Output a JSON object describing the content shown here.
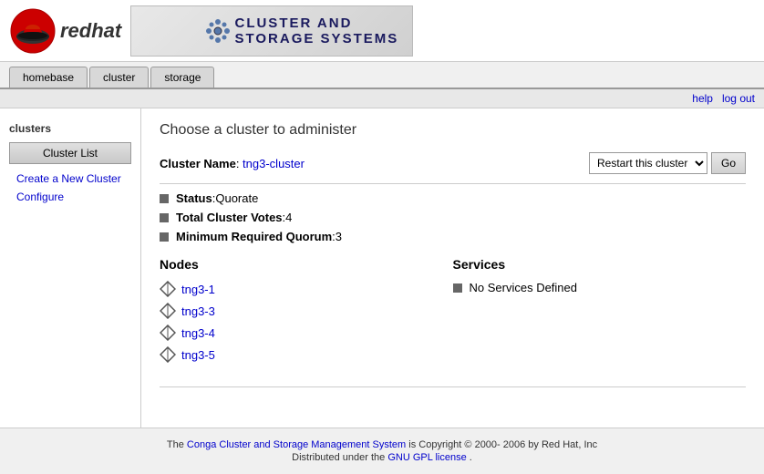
{
  "header": {
    "logo_text": "redhat",
    "banner_title_line1": "CLUSTER AND",
    "banner_title_line2": "STORAGE SYSTEMS"
  },
  "nav": {
    "tabs": [
      {
        "label": "homebase",
        "id": "homebase"
      },
      {
        "label": "cluster",
        "id": "cluster"
      },
      {
        "label": "storage",
        "id": "storage"
      }
    ]
  },
  "utility": {
    "help_label": "help",
    "logout_label": "log out"
  },
  "sidebar": {
    "title": "clusters",
    "cluster_list_btn": "Cluster List",
    "create_link": "Create a New Cluster",
    "configure_link": "Configure"
  },
  "content": {
    "page_title": "Choose a cluster to administer",
    "cluster_name_label": "Cluster Name",
    "cluster_name_value": "tng3-cluster",
    "restart_option": "Restart this cluster",
    "go_label": "Go",
    "status_label": "Status",
    "status_value": "Quorate",
    "votes_label": "Total Cluster Votes",
    "votes_value": "4",
    "quorum_label": "Minimum Required Quorum",
    "quorum_value": "3",
    "nodes_title": "Nodes",
    "nodes": [
      {
        "label": "tng3-1"
      },
      {
        "label": "tng3-3"
      },
      {
        "label": "tng3-4"
      },
      {
        "label": "tng3-5"
      }
    ],
    "services_title": "Services",
    "no_services": "No Services Defined"
  },
  "footer": {
    "prefix": "The",
    "link_text": "Conga Cluster and Storage Management System",
    "copyright": "is Copyright © 2000- 2006 by",
    "company": "Red Hat, Inc",
    "license_prefix": "Distributed under the",
    "license_link": "GNU GPL license",
    "license_suffix": "."
  }
}
